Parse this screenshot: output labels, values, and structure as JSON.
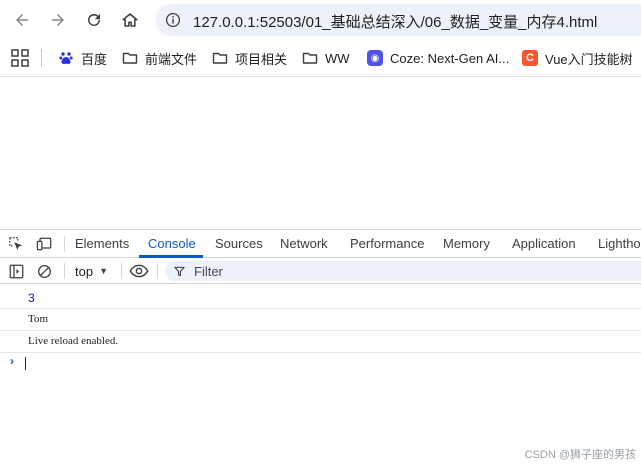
{
  "browser": {
    "url": "127.0.0.1:52503/01_基础总结深入/06_数据_变量_内存4.html",
    "icons": [
      "back-arrow-icon",
      "forward-arrow-icon",
      "reload-icon",
      "home-icon",
      "site-info-icon"
    ]
  },
  "bookmarks": {
    "items": [
      {
        "label": "百度",
        "icon": "baidu-paw-icon"
      },
      {
        "label": "前端文件",
        "icon": "folder-icon"
      },
      {
        "label": "项目相关",
        "icon": "folder-icon"
      },
      {
        "label": "WW",
        "icon": "folder-icon"
      },
      {
        "label": "Coze: Next-Gen AI...",
        "icon": "coze-icon"
      },
      {
        "label": "Vue入门技能树",
        "icon": "csdn-c-icon"
      }
    ]
  },
  "devtools": {
    "tabs": [
      "Elements",
      "Console",
      "Sources",
      "Network",
      "Performance",
      "Memory",
      "Application",
      "Lightho"
    ],
    "active_tab": "Console",
    "context": "top",
    "filter_placeholder": "Filter",
    "accent_color": "#0b57d0"
  },
  "console": {
    "lines": [
      "3",
      "Tom",
      "Live reload enabled."
    ]
  },
  "watermark": "CSDN @狮子座的男孩"
}
